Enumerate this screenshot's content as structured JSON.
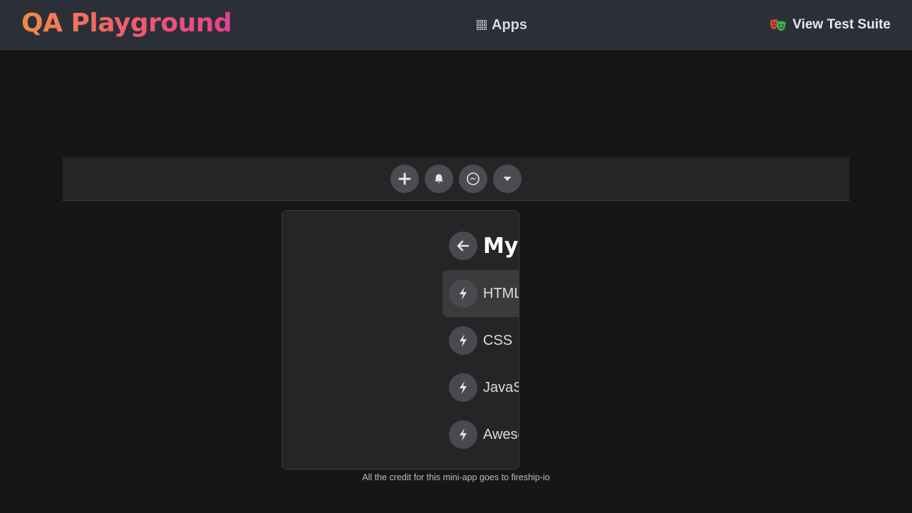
{
  "header": {
    "brand": "QA Playground",
    "apps_label": "Apps",
    "suite_label": "View Test Suite"
  },
  "navbar": {
    "buttons": [
      {
        "icon": "plus-icon"
      },
      {
        "icon": "bell-icon"
      },
      {
        "icon": "messenger-icon"
      },
      {
        "icon": "caret-down-icon"
      }
    ]
  },
  "dropdown": {
    "title": "My Tutorial",
    "items": [
      {
        "label": "HTML",
        "icon": "bolt-icon"
      },
      {
        "label": "CSS",
        "icon": "bolt-icon"
      },
      {
        "label": "JavaScript",
        "icon": "bolt-icon"
      },
      {
        "label": "Awesome!",
        "icon": "bolt-icon"
      }
    ]
  },
  "footer": {
    "credit": "All the credit for this mini-app goes to fireship-io"
  },
  "colors": {
    "background": "#151716",
    "topbar": "#2b2f38",
    "panel": "#242526",
    "button": "#4b4c4f",
    "brand_gradient_start": "#f28a4b",
    "brand_gradient_end": "#e6428f"
  }
}
